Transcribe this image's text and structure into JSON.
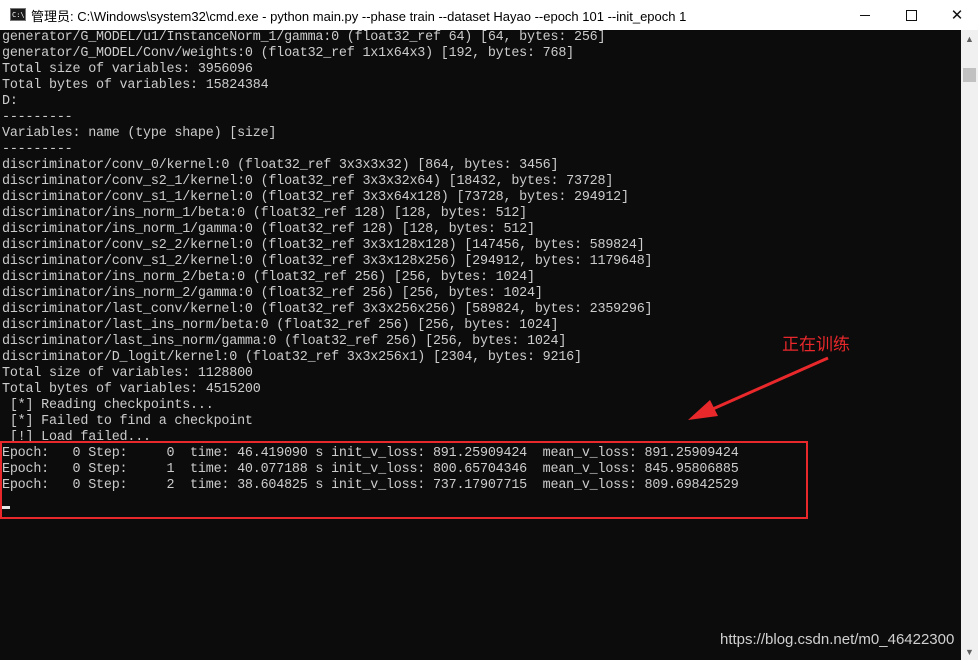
{
  "window": {
    "app_icon_text": "C:\\",
    "title": "管理员: C:\\Windows\\system32\\cmd.exe - python  main.py --phase train --dataset Hayao --epoch 101 --init_epoch 1",
    "minimize_icon": "minimize-icon",
    "maximize_icon": "maximize-icon",
    "close_icon": "close-icon",
    "close_glyph": "✕"
  },
  "console": {
    "background": "#0c0c0c",
    "text_color": "#cccccc",
    "lines": [
      "generator/G_MODEL/u1/InstanceNorm_1/gamma:0 (float32_ref 64) [64, bytes: 256]",
      "generator/G_MODEL/Conv/weights:0 (float32_ref 1x1x64x3) [192, bytes: 768]",
      "Total size of variables: 3956096",
      "Total bytes of variables: 15824384",
      "D:",
      "---------",
      "Variables: name (type shape) [size]",
      "---------",
      "discriminator/conv_0/kernel:0 (float32_ref 3x3x3x32) [864, bytes: 3456]",
      "discriminator/conv_s2_1/kernel:0 (float32_ref 3x3x32x64) [18432, bytes: 73728]",
      "discriminator/conv_s1_1/kernel:0 (float32_ref 3x3x64x128) [73728, bytes: 294912]",
      "discriminator/ins_norm_1/beta:0 (float32_ref 128) [128, bytes: 512]",
      "discriminator/ins_norm_1/gamma:0 (float32_ref 128) [128, bytes: 512]",
      "discriminator/conv_s2_2/kernel:0 (float32_ref 3x3x128x128) [147456, bytes: 589824]",
      "discriminator/conv_s1_2/kernel:0 (float32_ref 3x3x128x256) [294912, bytes: 1179648]",
      "discriminator/ins_norm_2/beta:0 (float32_ref 256) [256, bytes: 1024]",
      "discriminator/ins_norm_2/gamma:0 (float32_ref 256) [256, bytes: 1024]",
      "discriminator/last_conv/kernel:0 (float32_ref 3x3x256x256) [589824, bytes: 2359296]",
      "discriminator/last_ins_norm/beta:0 (float32_ref 256) [256, bytes: 1024]",
      "discriminator/last_ins_norm/gamma:0 (float32_ref 256) [256, bytes: 1024]",
      "discriminator/D_logit/kernel:0 (float32_ref 3x3x256x1) [2304, bytes: 9216]",
      "Total size of variables: 1128800",
      "Total bytes of variables: 4515200",
      " [*] Reading checkpoints...",
      " [*] Failed to find a checkpoint",
      " [!] Load failed...",
      "Epoch:   0 Step:     0  time: 46.419090 s init_v_loss: 891.25909424  mean_v_loss: 891.25909424",
      "Epoch:   0 Step:     1  time: 40.077188 s init_v_loss: 800.65704346  mean_v_loss: 845.95806885",
      "Epoch:   0 Step:     2  time: 38.604825 s init_v_loss: 737.17907715  mean_v_loss: 809.69842529"
    ]
  },
  "annotation": {
    "label": "正在训练",
    "color": "#e8282b"
  },
  "scrollbar": {
    "up_icon": "scroll-up-arrow-icon",
    "down_icon": "scroll-down-arrow-icon",
    "up_glyph": "▲",
    "down_glyph": "▼"
  },
  "watermark": "https://blog.csdn.net/m0_46422300"
}
